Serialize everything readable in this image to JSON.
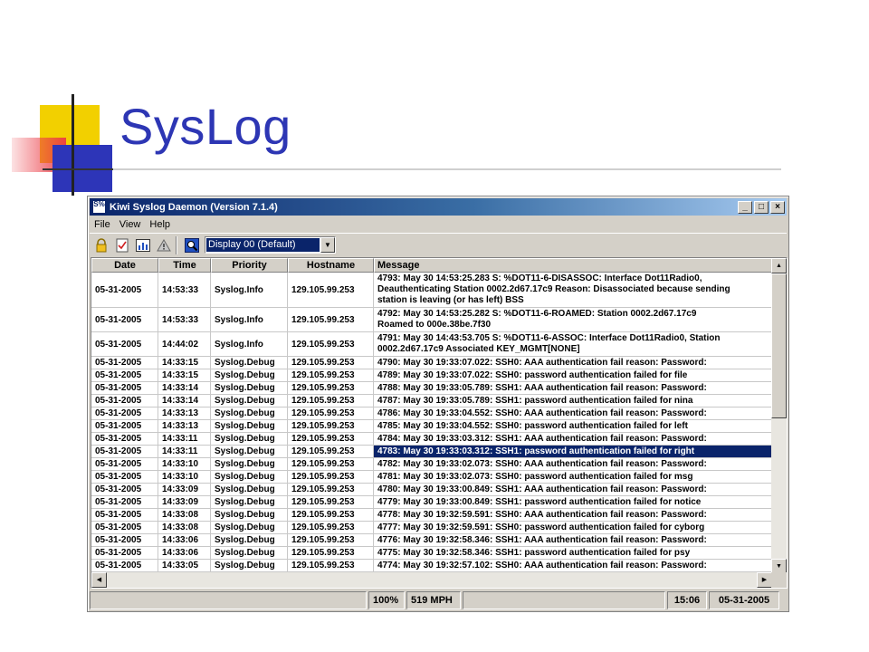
{
  "slide": {
    "title": "SysLog"
  },
  "window": {
    "title": "Kiwi Syslog Daemon (Version 7.1.4)",
    "app_icon": "S%",
    "buttons": {
      "minimize": "_",
      "maximize": "□",
      "close": "×"
    }
  },
  "menu": [
    "File",
    "View",
    "Help"
  ],
  "toolbar": {
    "icons": [
      "lock-icon",
      "checklist-icon",
      "chart-icon",
      "warning-icon",
      "zoom-icon"
    ],
    "display_select": "Display 00 (Default)"
  },
  "columns": [
    "Date",
    "Time",
    "Priority",
    "Hostname",
    "Message"
  ],
  "rows": [
    {
      "date": "05-31-2005",
      "time": "14:53:33",
      "priority": "Syslog.Info",
      "host": "129.105.99.253",
      "msg": "4793: May 30 14:53:25.283 S: %DOT11-6-DISASSOC: Interface Dot11Radio0,\nDeauthenticating Station 0002.2d67.17c9 Reason: Disassociated because sending\nstation is leaving (or has left) BSS"
    },
    {
      "date": "05-31-2005",
      "time": "14:53:33",
      "priority": "Syslog.Info",
      "host": "129.105.99.253",
      "msg": "4792: May 30 14:53:25.282 S: %DOT11-6-ROAMED: Station 0002.2d67.17c9\nRoamed to 000e.38be.7f30"
    },
    {
      "date": "05-31-2005",
      "time": "14:44:02",
      "priority": "Syslog.Info",
      "host": "129.105.99.253",
      "msg": "4791: May 30 14:43:53.705 S: %DOT11-6-ASSOC: Interface Dot11Radio0, Station\n 0002.2d67.17c9 Associated KEY_MGMT[NONE]"
    },
    {
      "date": "05-31-2005",
      "time": "14:33:15",
      "priority": "Syslog.Debug",
      "host": "129.105.99.253",
      "msg": "4790: May 30 19:33:07.022: SSH0: AAA authentication fail reason: Password:"
    },
    {
      "date": "05-31-2005",
      "time": "14:33:15",
      "priority": "Syslog.Debug",
      "host": "129.105.99.253",
      "msg": "4789: May 30 19:33:07.022: SSH0: password authentication failed for file"
    },
    {
      "date": "05-31-2005",
      "time": "14:33:14",
      "priority": "Syslog.Debug",
      "host": "129.105.99.253",
      "msg": "4788: May 30 19:33:05.789: SSH1: AAA authentication fail reason: Password:"
    },
    {
      "date": "05-31-2005",
      "time": "14:33:14",
      "priority": "Syslog.Debug",
      "host": "129.105.99.253",
      "msg": "4787: May 30 19:33:05.789: SSH1: password authentication failed for nina"
    },
    {
      "date": "05-31-2005",
      "time": "14:33:13",
      "priority": "Syslog.Debug",
      "host": "129.105.99.253",
      "msg": "4786: May 30 19:33:04.552: SSH0: AAA authentication fail reason: Password:"
    },
    {
      "date": "05-31-2005",
      "time": "14:33:13",
      "priority": "Syslog.Debug",
      "host": "129.105.99.253",
      "msg": "4785: May 30 19:33:04.552: SSH0: password authentication failed for left"
    },
    {
      "date": "05-31-2005",
      "time": "14:33:11",
      "priority": "Syslog.Debug",
      "host": "129.105.99.253",
      "msg": "4784: May 30 19:33:03.312: SSH1: AAA authentication fail reason: Password:"
    },
    {
      "date": "05-31-2005",
      "time": "14:33:11",
      "priority": "Syslog.Debug",
      "host": "129.105.99.253",
      "msg": "4783: May 30 19:33:03.312: SSH1: password authentication failed for right",
      "selected": true
    },
    {
      "date": "05-31-2005",
      "time": "14:33:10",
      "priority": "Syslog.Debug",
      "host": "129.105.99.253",
      "msg": "4782: May 30 19:33:02.073: SSH0: AAA authentication fail reason: Password:"
    },
    {
      "date": "05-31-2005",
      "time": "14:33:10",
      "priority": "Syslog.Debug",
      "host": "129.105.99.253",
      "msg": "4781: May 30 19:33:02.073: SSH0: password authentication failed for msg"
    },
    {
      "date": "05-31-2005",
      "time": "14:33:09",
      "priority": "Syslog.Debug",
      "host": "129.105.99.253",
      "msg": "4780: May 30 19:33:00.849: SSH1: AAA authentication fail reason: Password:"
    },
    {
      "date": "05-31-2005",
      "time": "14:33:09",
      "priority": "Syslog.Debug",
      "host": "129.105.99.253",
      "msg": "4779: May 30 19:33:00.849: SSH1: password authentication failed for notice"
    },
    {
      "date": "05-31-2005",
      "time": "14:33:08",
      "priority": "Syslog.Debug",
      "host": "129.105.99.253",
      "msg": "4778: May 30 19:32:59.591: SSH0: AAA authentication fail reason: Password:"
    },
    {
      "date": "05-31-2005",
      "time": "14:33:08",
      "priority": "Syslog.Debug",
      "host": "129.105.99.253",
      "msg": "4777: May 30 19:32:59.591: SSH0: password authentication failed for cyborg"
    },
    {
      "date": "05-31-2005",
      "time": "14:33:06",
      "priority": "Syslog.Debug",
      "host": "129.105.99.253",
      "msg": "4776: May 30 19:32:58.346: SSH1: AAA authentication fail reason: Password:"
    },
    {
      "date": "05-31-2005",
      "time": "14:33:06",
      "priority": "Syslog.Debug",
      "host": "129.105.99.253",
      "msg": "4775: May 30 19:32:58.346: SSH1: password authentication failed for psy"
    },
    {
      "date": "05-31-2005",
      "time": "14:33:05",
      "priority": "Syslog.Debug",
      "host": "129.105.99.253",
      "msg": "4774: May 30 19:32:57.102: SSH0: AAA authentication fail reason: Password:"
    }
  ],
  "status": {
    "zoom": "100%",
    "rate": "519 MPH",
    "time": "15:06",
    "date": "05-31-2005"
  },
  "colors": {
    "title": "#2d36b4",
    "selection": "#0a246a",
    "titlebar": "#0a246a"
  }
}
